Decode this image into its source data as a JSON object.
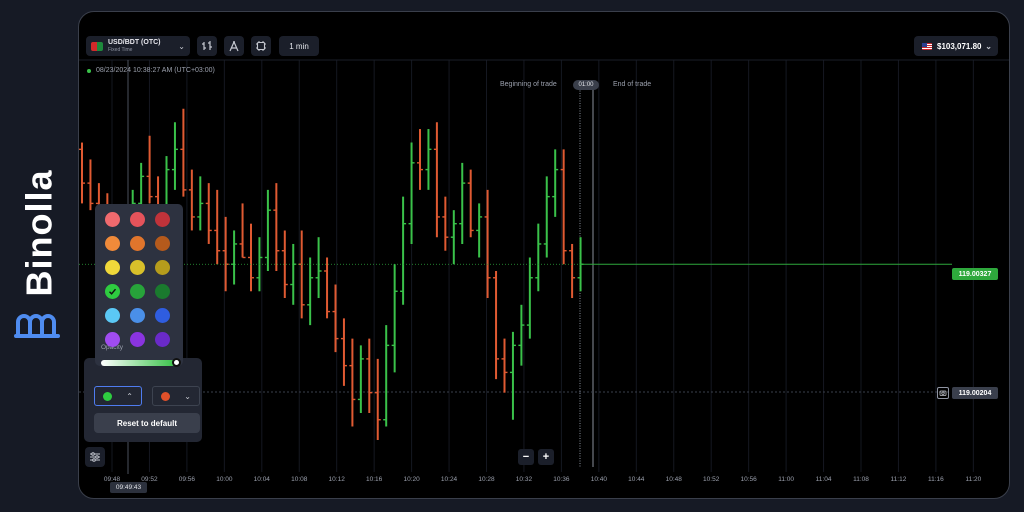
{
  "brand": {
    "name": "Binolla"
  },
  "header": {
    "pair_name": "USD/BDT (OTC)",
    "pair_type": "Fixed Time",
    "timeframe": "1 min",
    "balance": "$103,071.80"
  },
  "chart": {
    "datetime": "08/23/2024 10:38:27 AM (UTC+03:00)",
    "beginning_label": "Beginning of trade",
    "end_label": "End of trade",
    "timer": "01:00",
    "current_price": "119.00327",
    "reference_price": "119.00204",
    "current_time": "09:49:43",
    "x_ticks": [
      "09:48",
      "09:52",
      "09:56",
      "10:00",
      "10:04",
      "10:08",
      "10:12",
      "10:16",
      "10:20",
      "10:24",
      "10:28",
      "10:32",
      "10:36",
      "10:40",
      "10:44",
      "10:48",
      "10:52",
      "10:56",
      "11:00",
      "11:04",
      "11:08",
      "11:12",
      "11:16",
      "11:20"
    ]
  },
  "chart_data": {
    "type": "bar",
    "style": "ohlc",
    "up_color": "#3ac24a",
    "down_color": "#e05a32",
    "y_scale": "pixel-relative (no printed y axis)",
    "bars": [
      {
        "i": 0,
        "o": 0.86,
        "h": 0.88,
        "l": 0.7,
        "c": 0.76
      },
      {
        "i": 1,
        "o": 0.76,
        "h": 0.83,
        "l": 0.68,
        "c": 0.7
      },
      {
        "i": 2,
        "o": 0.7,
        "h": 0.76,
        "l": 0.6,
        "c": 0.65
      },
      {
        "i": 3,
        "o": 0.65,
        "h": 0.73,
        "l": 0.48,
        "c": 0.52
      },
      {
        "i": 4,
        "o": 0.52,
        "h": 0.62,
        "l": 0.45,
        "c": 0.56
      },
      {
        "i": 5,
        "o": 0.56,
        "h": 0.68,
        "l": 0.52,
        "c": 0.6
      },
      {
        "i": 6,
        "o": 0.6,
        "h": 0.74,
        "l": 0.54,
        "c": 0.7
      },
      {
        "i": 7,
        "o": 0.7,
        "h": 0.82,
        "l": 0.62,
        "c": 0.78
      },
      {
        "i": 8,
        "o": 0.78,
        "h": 0.9,
        "l": 0.7,
        "c": 0.72
      },
      {
        "i": 9,
        "o": 0.72,
        "h": 0.78,
        "l": 0.6,
        "c": 0.66
      },
      {
        "i": 10,
        "o": 0.66,
        "h": 0.84,
        "l": 0.62,
        "c": 0.8
      },
      {
        "i": 11,
        "o": 0.8,
        "h": 0.94,
        "l": 0.74,
        "c": 0.86
      },
      {
        "i": 12,
        "o": 0.86,
        "h": 0.98,
        "l": 0.72,
        "c": 0.74
      },
      {
        "i": 13,
        "o": 0.74,
        "h": 0.8,
        "l": 0.62,
        "c": 0.66
      },
      {
        "i": 14,
        "o": 0.66,
        "h": 0.78,
        "l": 0.62,
        "c": 0.7
      },
      {
        "i": 15,
        "o": 0.7,
        "h": 0.76,
        "l": 0.58,
        "c": 0.62
      },
      {
        "i": 16,
        "o": 0.62,
        "h": 0.74,
        "l": 0.52,
        "c": 0.56
      },
      {
        "i": 17,
        "o": 0.56,
        "h": 0.66,
        "l": 0.44,
        "c": 0.52
      },
      {
        "i": 18,
        "o": 0.52,
        "h": 0.62,
        "l": 0.46,
        "c": 0.58
      },
      {
        "i": 19,
        "o": 0.58,
        "h": 0.7,
        "l": 0.54,
        "c": 0.54
      },
      {
        "i": 20,
        "o": 0.54,
        "h": 0.64,
        "l": 0.44,
        "c": 0.48
      },
      {
        "i": 21,
        "o": 0.48,
        "h": 0.6,
        "l": 0.44,
        "c": 0.54
      },
      {
        "i": 22,
        "o": 0.54,
        "h": 0.74,
        "l": 0.5,
        "c": 0.68
      },
      {
        "i": 23,
        "o": 0.68,
        "h": 0.76,
        "l": 0.5,
        "c": 0.56
      },
      {
        "i": 24,
        "o": 0.56,
        "h": 0.62,
        "l": 0.42,
        "c": 0.46
      },
      {
        "i": 25,
        "o": 0.46,
        "h": 0.58,
        "l": 0.4,
        "c": 0.52
      },
      {
        "i": 26,
        "o": 0.52,
        "h": 0.62,
        "l": 0.36,
        "c": 0.4
      },
      {
        "i": 27,
        "o": 0.4,
        "h": 0.54,
        "l": 0.34,
        "c": 0.48
      },
      {
        "i": 28,
        "o": 0.48,
        "h": 0.6,
        "l": 0.42,
        "c": 0.5
      },
      {
        "i": 29,
        "o": 0.5,
        "h": 0.54,
        "l": 0.36,
        "c": 0.38
      },
      {
        "i": 30,
        "o": 0.38,
        "h": 0.46,
        "l": 0.26,
        "c": 0.3
      },
      {
        "i": 31,
        "o": 0.3,
        "h": 0.36,
        "l": 0.16,
        "c": 0.22
      },
      {
        "i": 32,
        "o": 0.22,
        "h": 0.3,
        "l": 0.04,
        "c": 0.12
      },
      {
        "i": 33,
        "o": 0.12,
        "h": 0.28,
        "l": 0.08,
        "c": 0.24
      },
      {
        "i": 34,
        "o": 0.24,
        "h": 0.3,
        "l": 0.08,
        "c": 0.14
      },
      {
        "i": 35,
        "o": 0.14,
        "h": 0.24,
        "l": 0.0,
        "c": 0.06
      },
      {
        "i": 36,
        "o": 0.06,
        "h": 0.34,
        "l": 0.04,
        "c": 0.28
      },
      {
        "i": 37,
        "o": 0.28,
        "h": 0.52,
        "l": 0.2,
        "c": 0.44
      },
      {
        "i": 38,
        "o": 0.44,
        "h": 0.72,
        "l": 0.4,
        "c": 0.64
      },
      {
        "i": 39,
        "o": 0.64,
        "h": 0.88,
        "l": 0.58,
        "c": 0.82
      },
      {
        "i": 40,
        "o": 0.82,
        "h": 0.92,
        "l": 0.74,
        "c": 0.8
      },
      {
        "i": 41,
        "o": 0.8,
        "h": 0.92,
        "l": 0.74,
        "c": 0.86
      },
      {
        "i": 42,
        "o": 0.86,
        "h": 0.94,
        "l": 0.6,
        "c": 0.66
      },
      {
        "i": 43,
        "o": 0.66,
        "h": 0.72,
        "l": 0.56,
        "c": 0.6
      },
      {
        "i": 44,
        "o": 0.6,
        "h": 0.68,
        "l": 0.52,
        "c": 0.64
      },
      {
        "i": 45,
        "o": 0.64,
        "h": 0.82,
        "l": 0.58,
        "c": 0.76
      },
      {
        "i": 46,
        "o": 0.76,
        "h": 0.8,
        "l": 0.6,
        "c": 0.62
      },
      {
        "i": 47,
        "o": 0.62,
        "h": 0.7,
        "l": 0.54,
        "c": 0.66
      },
      {
        "i": 48,
        "o": 0.66,
        "h": 0.74,
        "l": 0.42,
        "c": 0.48
      },
      {
        "i": 49,
        "o": 0.48,
        "h": 0.5,
        "l": 0.18,
        "c": 0.24
      },
      {
        "i": 50,
        "o": 0.24,
        "h": 0.3,
        "l": 0.14,
        "c": 0.2
      },
      {
        "i": 51,
        "o": 0.2,
        "h": 0.32,
        "l": 0.06,
        "c": 0.28
      },
      {
        "i": 52,
        "o": 0.28,
        "h": 0.4,
        "l": 0.22,
        "c": 0.34
      },
      {
        "i": 53,
        "o": 0.34,
        "h": 0.54,
        "l": 0.3,
        "c": 0.48
      },
      {
        "i": 54,
        "o": 0.48,
        "h": 0.64,
        "l": 0.44,
        "c": 0.58
      },
      {
        "i": 55,
        "o": 0.58,
        "h": 0.78,
        "l": 0.54,
        "c": 0.72
      },
      {
        "i": 56,
        "o": 0.72,
        "h": 0.86,
        "l": 0.66,
        "c": 0.8
      },
      {
        "i": 57,
        "o": 0.8,
        "h": 0.86,
        "l": 0.52,
        "c": 0.56
      },
      {
        "i": 58,
        "o": 0.56,
        "h": 0.58,
        "l": 0.42,
        "c": 0.48
      },
      {
        "i": 59,
        "o": 0.48,
        "h": 0.6,
        "l": 0.44,
        "c": 0.52
      }
    ]
  },
  "color_picker": {
    "opacity_label": "Opacity",
    "opacity_value": 1.0,
    "reset_label": "Reset to default",
    "up_color": "#2ecc40",
    "down_color": "#e0502a",
    "swatches": [
      [
        "#f06a6e",
        "#e5535b",
        "#c0333a"
      ],
      [
        "#f08a3a",
        "#e0752c",
        "#b55a1c"
      ],
      [
        "#f0d83a",
        "#d8c02a",
        "#b59c1c"
      ],
      [
        "#2ecc40",
        "#27a33a",
        "#1a7a2e"
      ],
      [
        "#5bc8f5",
        "#4a8fe8",
        "#2f5de0"
      ],
      [
        "#a04cf0",
        "#8a34e0",
        "#6a2ac8"
      ]
    ],
    "selected_swatch": "3-0"
  }
}
